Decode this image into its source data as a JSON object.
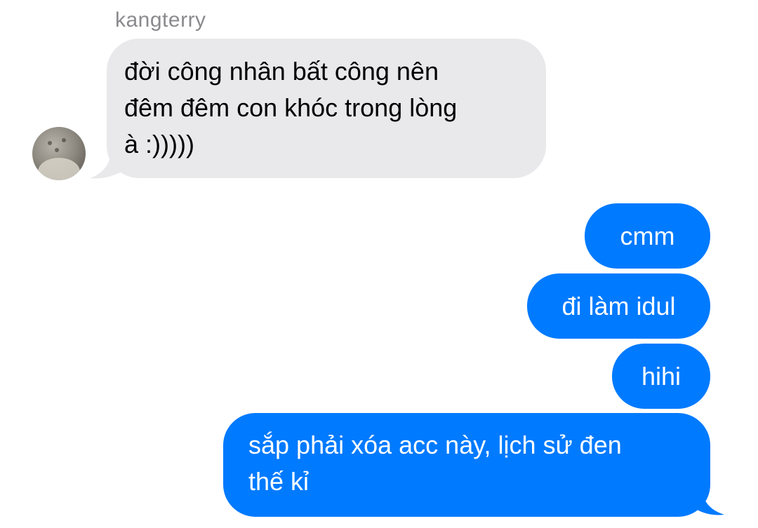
{
  "conversation": {
    "incoming": {
      "sender": "kangterry",
      "message_lines": [
        "đời công nhân bất công nên",
        "đêm đêm con khóc trong lòng",
        "à :)))))"
      ]
    },
    "outgoing": [
      {
        "text": "cmm"
      },
      {
        "text": "đi làm idul"
      },
      {
        "text": "hihi"
      },
      {
        "lines": [
          "sắp phải xóa acc này, lịch sử đen",
          "thế kỉ"
        ]
      }
    ]
  },
  "colors": {
    "incoming_bubble": "#e9e9eb",
    "outgoing_bubble": "#007aff",
    "sender_name": "#8a8a8e"
  },
  "icons": {
    "avatar": "profile-photo"
  }
}
